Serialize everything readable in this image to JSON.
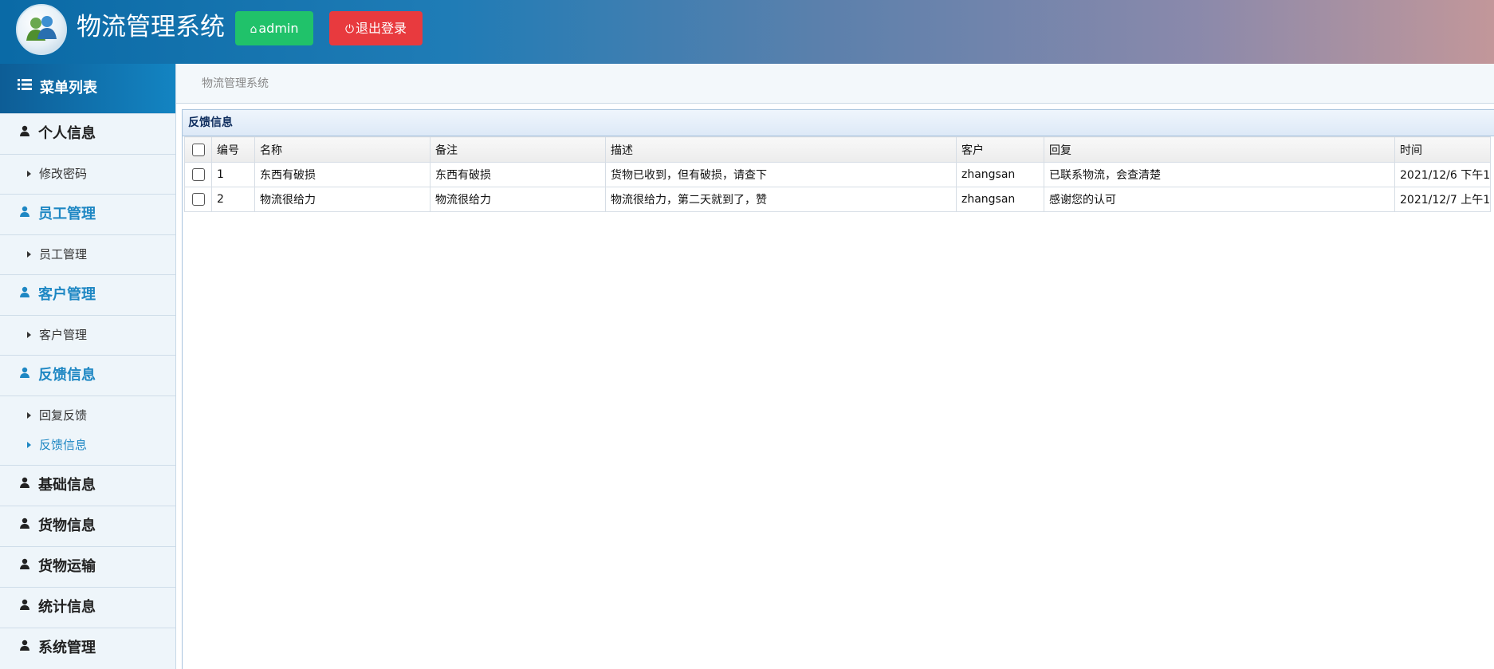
{
  "header": {
    "app_title": "物流管理系统",
    "admin_label": "admin",
    "logout_label": "退出登录"
  },
  "sidebar": {
    "title": "菜单列表",
    "groups": [
      {
        "label": "个人信息",
        "active": false,
        "items": [
          {
            "label": "修改密码",
            "active": false
          }
        ]
      },
      {
        "label": "员工管理",
        "active": true,
        "items": [
          {
            "label": "员工管理",
            "active": false
          }
        ]
      },
      {
        "label": "客户管理",
        "active": true,
        "items": [
          {
            "label": "客户管理",
            "active": false
          }
        ]
      },
      {
        "label": "反馈信息",
        "active": true,
        "items": [
          {
            "label": "回复反馈",
            "active": false
          },
          {
            "label": "反馈信息",
            "active": true
          }
        ]
      },
      {
        "label": "基础信息",
        "active": false,
        "items": []
      },
      {
        "label": "货物信息",
        "active": false,
        "items": []
      },
      {
        "label": "货物运输",
        "active": false,
        "items": []
      },
      {
        "label": "统计信息",
        "active": false,
        "items": []
      },
      {
        "label": "系统管理",
        "active": false,
        "items": []
      }
    ]
  },
  "breadcrumb": "物流管理系统",
  "panel": {
    "title": "反馈信息",
    "columns": [
      "编号",
      "名称",
      "备注",
      "描述",
      "客户",
      "回复",
      "时间"
    ],
    "rows": [
      [
        "1",
        "东西有破损",
        "东西有破损",
        "货物已收到，但有破损，请查下",
        "zhangsan",
        "已联系物流，会查清楚",
        "2021/12/6 下午1"
      ],
      [
        "2",
        "物流很给力",
        "物流很给力",
        "物流很给力，第二天就到了，赞",
        "zhangsan",
        "感谢您的认可",
        "2021/12/7 上午1"
      ]
    ]
  },
  "colors": {
    "admin_button": "#20c26a",
    "logout_button": "#e83a3e",
    "active_link": "#1e87c3",
    "sidebar_header": "#1384c2"
  }
}
